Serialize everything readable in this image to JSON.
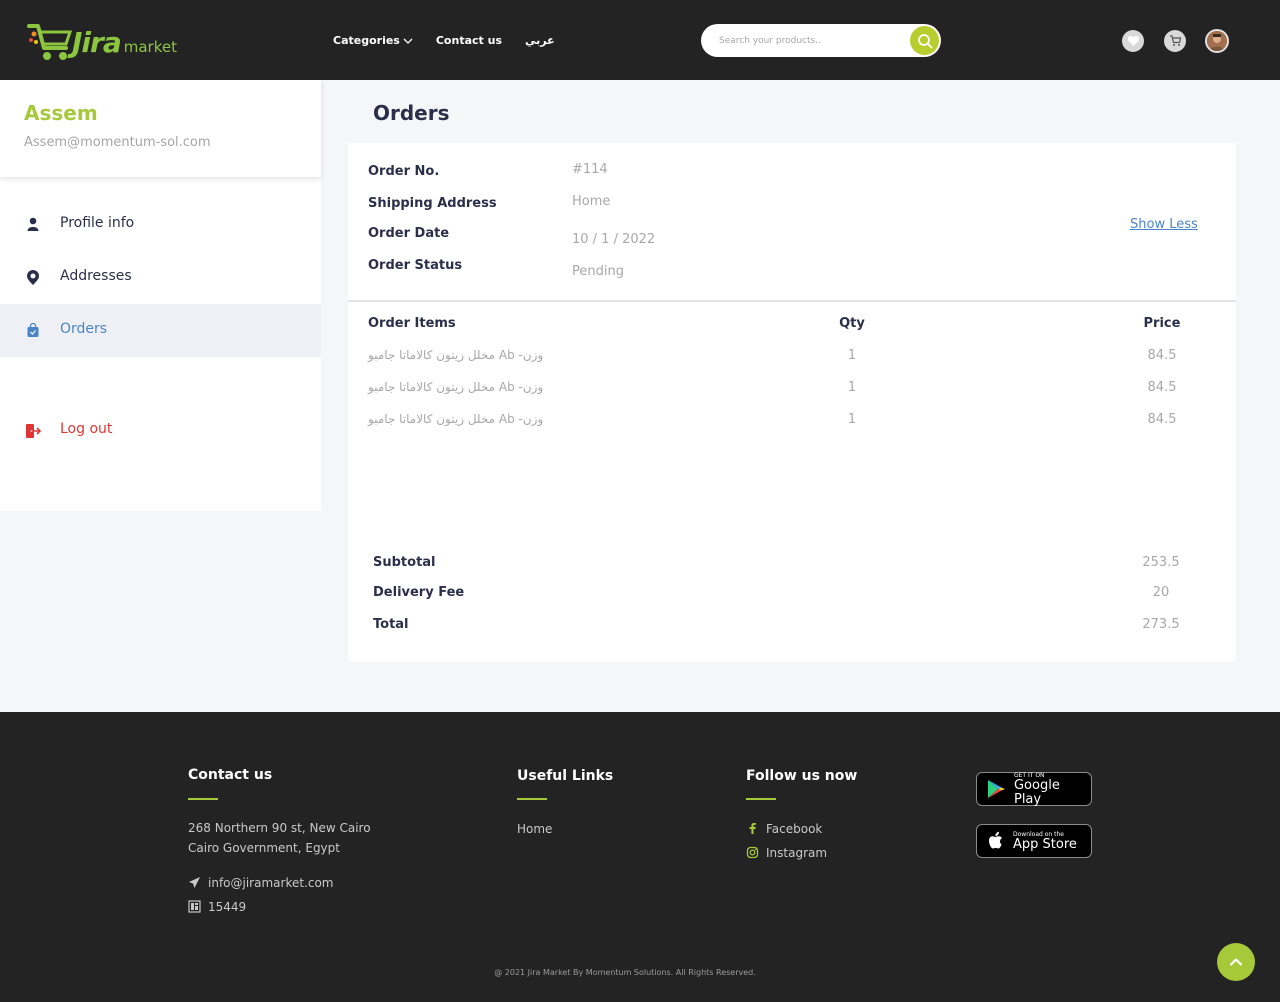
{
  "header": {
    "logo_main": "Jira",
    "logo_sub": "market",
    "nav": {
      "categories": "Categories",
      "contact": "Contact us",
      "language": "عربي"
    },
    "search": {
      "placeholder": "Search your products..",
      "value": ""
    }
  },
  "sidebar": {
    "user_name": "Assem",
    "user_email": "Assem@momentum-sol.com",
    "items": [
      {
        "label": "Profile info"
      },
      {
        "label": "Addresses"
      },
      {
        "label": "Orders"
      },
      {
        "label": "Log out"
      }
    ]
  },
  "main": {
    "title": "Orders",
    "order": {
      "number_label": "Order No.",
      "number": "#114",
      "address_label": "Shipping Address",
      "address": "Home",
      "date_label": "Order Date",
      "date": "10 / 1 / 2022",
      "status_label": "Order Status",
      "status": "Pending",
      "toggle_label": "Show Less"
    },
    "items_table": {
      "headers": [
        "Order Items",
        "Qty",
        "Price"
      ],
      "rows": [
        {
          "name": "مخلل زيتون كالاماتا جامبو Ab -وزن",
          "qty": "1",
          "price": "84.5"
        },
        {
          "name": "مخلل زيتون كالاماتا جامبو Ab -وزن",
          "qty": "1",
          "price": "84.5"
        },
        {
          "name": "مخلل زيتون كالاماتا جامبو Ab -وزن",
          "qty": "1",
          "price": "84.5"
        }
      ]
    },
    "summary": {
      "subtotal_label": "Subtotal",
      "subtotal": "253.5",
      "delivery_label": "Delivery Fee",
      "delivery": "20",
      "total_label": "Total",
      "total": "273.5"
    }
  },
  "footer": {
    "contact": {
      "heading": "Contact us",
      "address_line1": "268 Northern 90 st, New Cairo",
      "address_line2": "Cairo Government, Egypt",
      "email": "info@jiramarket.com",
      "phone": "15449"
    },
    "links": {
      "heading": "Useful Links",
      "items": [
        "Home"
      ]
    },
    "social": {
      "heading": "Follow us now",
      "facebook": "Facebook",
      "instagram": "Instagram"
    },
    "stores": {
      "google_small": "GET IT ON",
      "google_big": "Google Play",
      "apple_small": "Download on the",
      "apple_big": "App Store"
    },
    "copyright": "@ 2021 Jira Market By Momentum Solutions. All Rights Reserved."
  },
  "colors": {
    "header_bg": "#232323",
    "accent_green": "#a6c93a",
    "active_blue": "#4a86c5",
    "logout_red": "#e03535",
    "text_dark": "#2b2f4a"
  },
  "icons": [
    "search-icon",
    "heart-icon",
    "cart-icon",
    "user-icon",
    "location-pin-icon",
    "bag-icon",
    "logout-icon",
    "paper-plane-icon",
    "phone-icon",
    "facebook-icon",
    "instagram-icon",
    "google-play-icon",
    "apple-icon",
    "chevron-up-icon",
    "chevron-down-icon"
  ]
}
